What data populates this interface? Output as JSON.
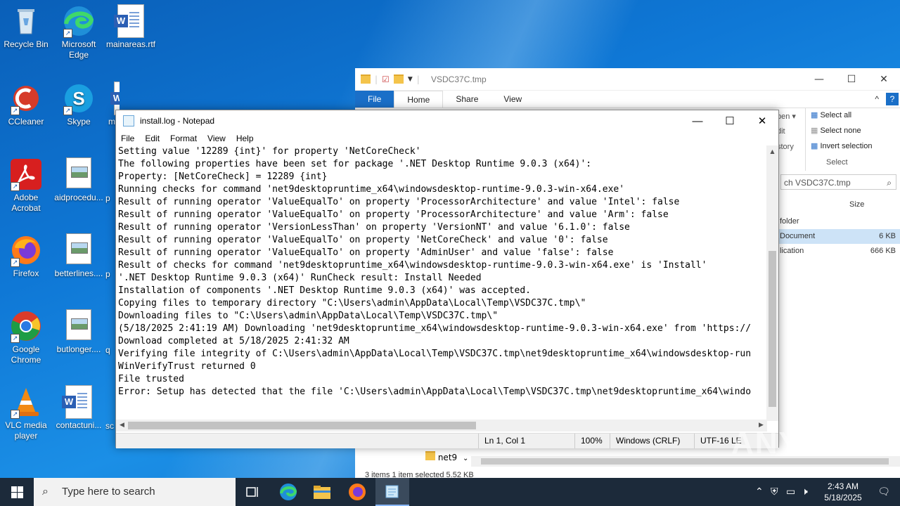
{
  "desktop": {
    "icons": [
      {
        "label": "Recycle Bin"
      },
      {
        "label": "Microsoft Edge"
      },
      {
        "label": "mainareas.rtf"
      },
      {
        "label": "CCleaner"
      },
      {
        "label": "Skype"
      },
      {
        "label": "m"
      },
      {
        "label": "Adobe Acrobat"
      },
      {
        "label": "aidprocedu..."
      },
      {
        "label": "p"
      },
      {
        "label": "Firefox"
      },
      {
        "label": "betterlines...."
      },
      {
        "label": "p"
      },
      {
        "label": "Google Chrome"
      },
      {
        "label": "butlonger...."
      },
      {
        "label": "q"
      },
      {
        "label": "VLC media player"
      },
      {
        "label": "contactuni..."
      },
      {
        "label": "sc"
      }
    ]
  },
  "explorer": {
    "title": "VSDC37C.tmp",
    "tabs": {
      "file": "File",
      "home": "Home",
      "share": "Share",
      "view": "View"
    },
    "ribbon": {
      "open": "pen ▾",
      "edit": "dit",
      "history": "story",
      "select_all": "Select all",
      "select_none": "Select none",
      "invert": "Invert selection",
      "group": "Select"
    },
    "search_placeholder": "ch VSDC37C.tmp",
    "columns": {
      "size": "Size"
    },
    "rows": [
      {
        "name": "folder",
        "size": ""
      },
      {
        "name": "Document",
        "size": "6 KB"
      },
      {
        "name": "lication",
        "size": "666 KB"
      }
    ],
    "left_item": "net9",
    "status": "3 items    1 item selected  5.52 KB"
  },
  "notepad": {
    "title": "install.log - Notepad",
    "menu": [
      "File",
      "Edit",
      "Format",
      "View",
      "Help"
    ],
    "lines": [
      "Setting value '12289 {int}' for property 'NetCoreCheck'",
      "The following properties have been set for package '.NET Desktop Runtime 9.0.3 (x64)':",
      "Property: [NetCoreCheck] = 12289 {int}",
      "Running checks for command 'net9desktopruntime_x64\\windowsdesktop-runtime-9.0.3-win-x64.exe'",
      "Result of running operator 'ValueEqualTo' on property 'ProcessorArchitecture' and value 'Intel': false",
      "Result of running operator 'ValueEqualTo' on property 'ProcessorArchitecture' and value 'Arm': false",
      "Result of running operator 'VersionLessThan' on property 'VersionNT' and value '6.1.0': false",
      "Result of running operator 'ValueEqualTo' on property 'NetCoreCheck' and value '0': false",
      "Result of running operator 'ValueEqualTo' on property 'AdminUser' and value 'false': false",
      "Result of checks for command 'net9desktopruntime_x64\\windowsdesktop-runtime-9.0.3-win-x64.exe' is 'Install'",
      "'.NET Desktop Runtime 9.0.3 (x64)' RunCheck result: Install Needed",
      "Installation of components '.NET Desktop Runtime 9.0.3 (x64)' was accepted.",
      "Copying files to temporary directory \"C:\\Users\\admin\\AppData\\Local\\Temp\\VSDC37C.tmp\\\"",
      "Downloading files to \"C:\\Users\\admin\\AppData\\Local\\Temp\\VSDC37C.tmp\\\"",
      "(5/18/2025 2:41:19 AM) Downloading 'net9desktopruntime_x64\\windowsdesktop-runtime-9.0.3-win-x64.exe' from 'https://",
      "Download completed at 5/18/2025 2:41:32 AM",
      "Verifying file integrity of C:\\Users\\admin\\AppData\\Local\\Temp\\VSDC37C.tmp\\net9desktopruntime_x64\\windowsdesktop-run",
      "WinVerifyTrust returned 0",
      "File trusted",
      "Error: Setup has detected that the file 'C:\\Users\\admin\\AppData\\Local\\Temp\\VSDC37C.tmp\\net9desktopruntime_x64\\windo"
    ],
    "status": {
      "position": "Ln 1, Col 1",
      "zoom": "100%",
      "eol": "Windows (CRLF)",
      "encoding": "UTF-16 LE"
    }
  },
  "taskbar": {
    "search_placeholder": "Type here to search",
    "time": "2:43 AM",
    "date": "5/18/2025"
  },
  "watermark": "ANY RUN"
}
